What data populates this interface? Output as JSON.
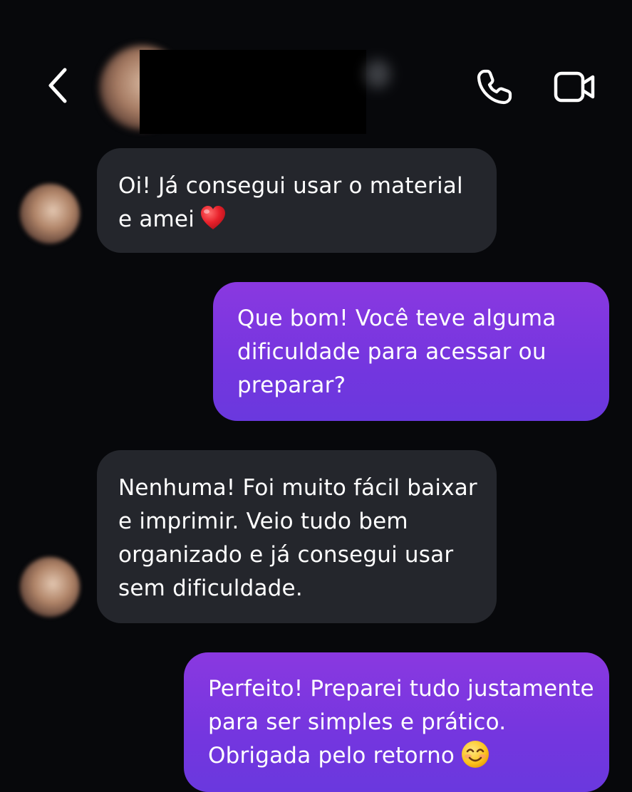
{
  "header": {
    "back_icon": "chevron-left-icon",
    "call_icon": "phone-icon",
    "video_icon": "video-camera-icon"
  },
  "messages": [
    {
      "direction": "incoming",
      "lines": [
        "Oi! Já consegui usar o material",
        "e amei"
      ],
      "emoji": "heart"
    },
    {
      "direction": "outgoing",
      "lines": [
        "Que bom! Você teve alguma",
        "dificuldade para acessar ou",
        "preparar?"
      ]
    },
    {
      "direction": "incoming",
      "lines": [
        "Nenhuma! Foi muito fácil baixar",
        "e imprimir. Veio tudo bem",
        "organizado e já consegui usar",
        "sem dificuldade."
      ]
    },
    {
      "direction": "outgoing",
      "lines": [
        "Perfeito! Preparei tudo justamente",
        "para ser simples e prático.",
        "Obrigada pelo retorno"
      ],
      "emoji": "smile"
    }
  ],
  "colors": {
    "background": "#07080b",
    "incoming_bubble": "#24262c",
    "outgoing_bubble": "#7a36e0",
    "text": "#ffffff"
  }
}
